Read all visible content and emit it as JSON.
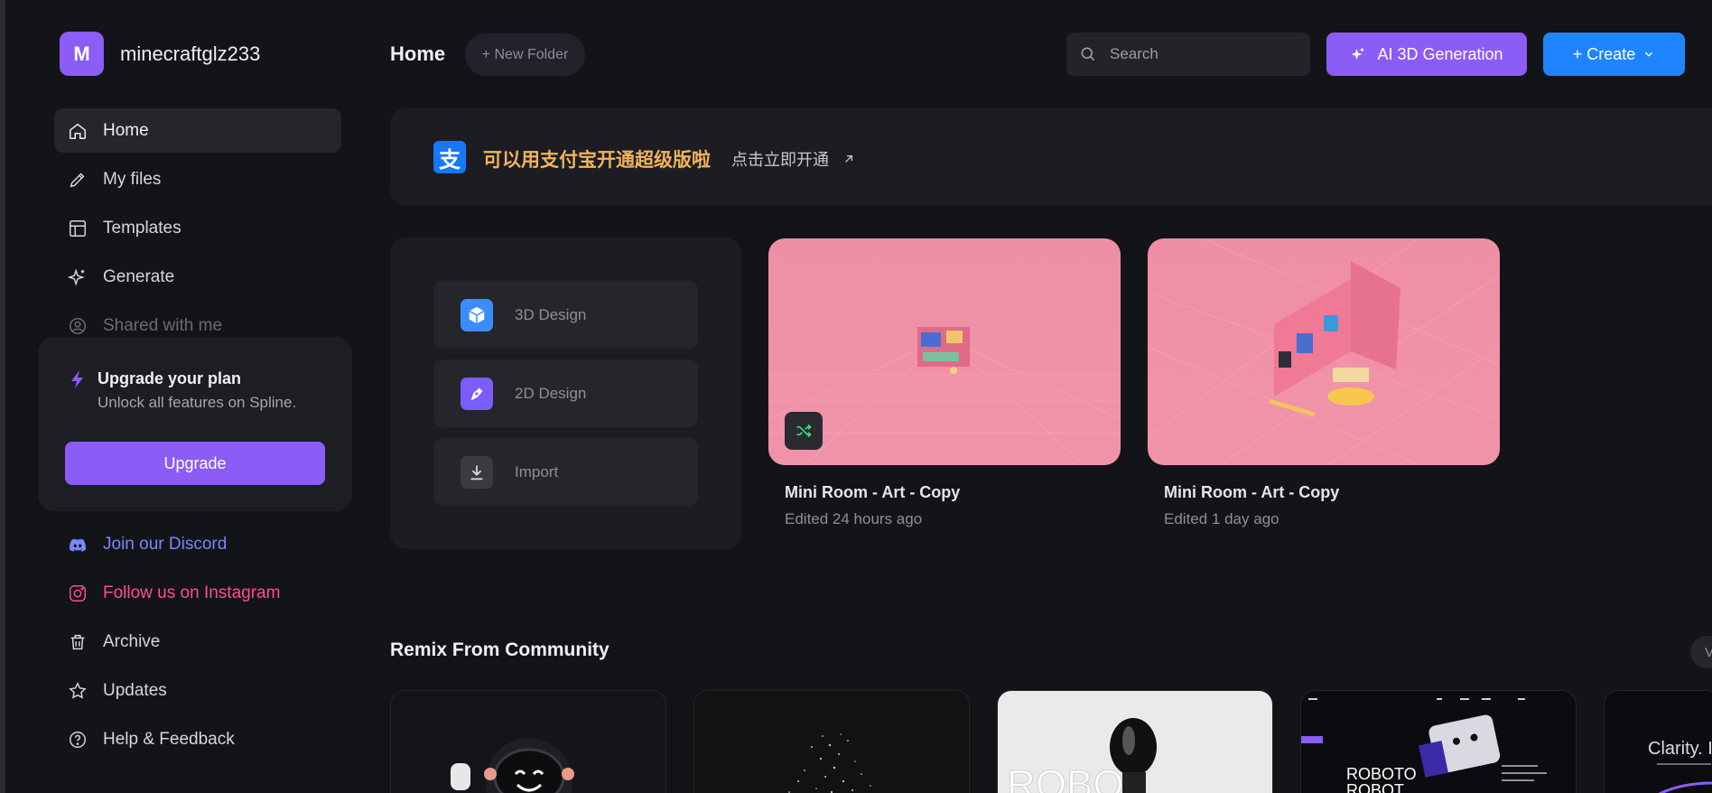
{
  "user": {
    "initial": "M",
    "name": "minecraftglz233"
  },
  "nav": [
    {
      "label": "Home",
      "icon": "home-icon"
    },
    {
      "label": "My files",
      "icon": "pencil-icon"
    },
    {
      "label": "Templates",
      "icon": "templates-icon"
    },
    {
      "label": "Generate",
      "icon": "sparkle-icon"
    },
    {
      "label": "Shared with me",
      "icon": "user-circle-icon"
    }
  ],
  "upgrade": {
    "title": "Upgrade your plan",
    "subtitle": "Unlock all features on Spline.",
    "button": "Upgrade"
  },
  "nav_bottom": [
    {
      "label": "Join our Discord",
      "icon": "discord-icon"
    },
    {
      "label": "Follow us on Instagram",
      "icon": "instagram-icon"
    },
    {
      "label": "Archive",
      "icon": "trash-icon"
    },
    {
      "label": "Updates",
      "icon": "star-icon"
    },
    {
      "label": "Help & Feedback",
      "icon": "help-icon"
    }
  ],
  "header": {
    "title": "Home",
    "new_folder": "+ New Folder",
    "search_placeholder": "Search",
    "ai_button": "AI 3D Generation",
    "create_button": "+ Create"
  },
  "banner": {
    "icon_char": "支",
    "text": "可以用支付宝开通超级版啦",
    "link": "点击立即开通"
  },
  "quick_create": [
    {
      "label": "3D Design",
      "color": "#3b8cff"
    },
    {
      "label": "2D Design",
      "color": "#7b5cff"
    },
    {
      "label": "Import",
      "color": "#3a3b41"
    }
  ],
  "files": [
    {
      "title": "Mini Room - Art - Copy",
      "edited": "Edited 24 hours ago"
    },
    {
      "title": "Mini Room - Art - Copy",
      "edited": "Edited 1 day ago"
    }
  ],
  "community": {
    "title": "Remix From Community",
    "view_all": "V"
  },
  "colors": {
    "accent_purple": "#8b5cf6",
    "accent_blue": "#1e84ff",
    "banner_gold": "#f0b35b",
    "thumb_pink": "#f093a9"
  }
}
